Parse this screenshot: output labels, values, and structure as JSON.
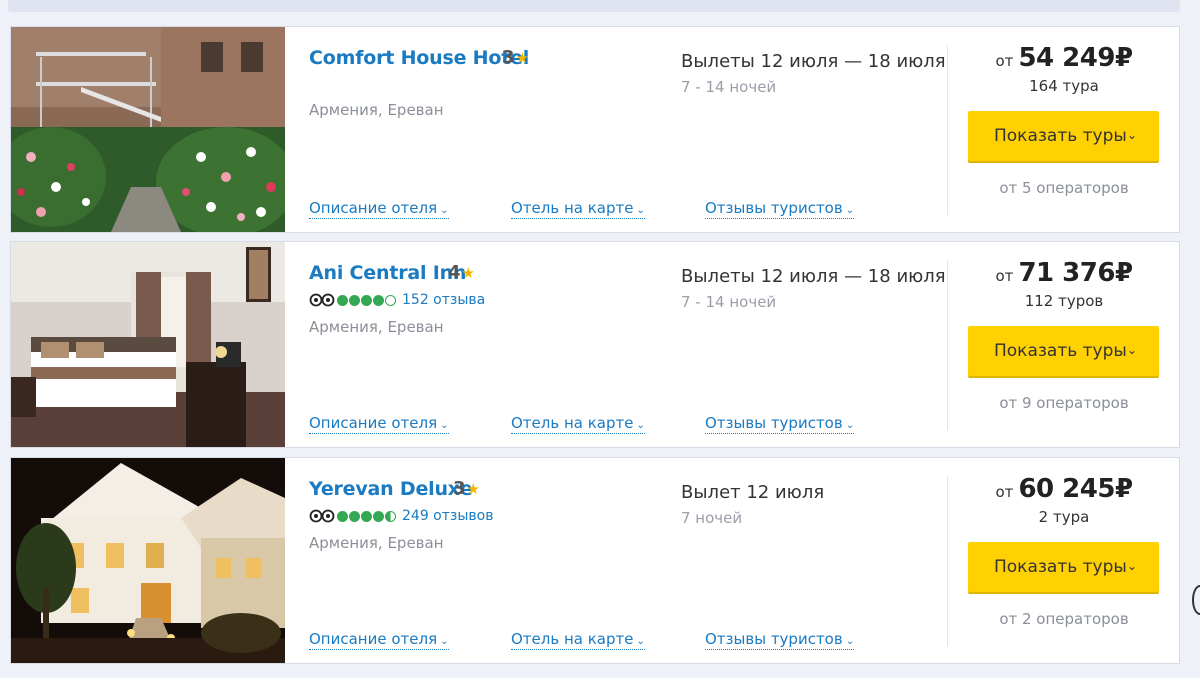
{
  "hotels": [
    {
      "name": "Comfort House Hotel",
      "stars": "3",
      "location": "Армения, Ереван",
      "has_rating": false,
      "dates": "Вылеты 12 июля — 18 июля",
      "nights": "7 - 14 ночей",
      "price_from": "от",
      "price": "54 249₽",
      "tours": "164 тура",
      "button": "Показать туры",
      "operators": "от 5 операторов",
      "links": [
        "Описание отеля",
        "Отель на карте",
        "Отзывы туристов"
      ]
    },
    {
      "name": "Ani Central Inn",
      "stars": "4",
      "location": "Армения, Ереван",
      "has_rating": true,
      "rating_bubbles": 4,
      "reviews": "152 отзыва",
      "dates": "Вылеты 12 июля — 18 июля",
      "nights": "7 - 14 ночей",
      "price_from": "от",
      "price": "71 376₽",
      "tours": "112 туров",
      "button": "Показать туры",
      "operators": "от 9 операторов",
      "links": [
        "Описание отеля",
        "Отель на карте",
        "Отзывы туристов"
      ]
    },
    {
      "name": "Yerevan Deluxe",
      "stars": "3",
      "location": "Армения, Ереван",
      "has_rating": true,
      "rating_bubbles": 4.5,
      "reviews": "249 отзывов",
      "dates": "Вылет 12 июля",
      "nights": "7 ночей",
      "price_from": "от",
      "price": "60 245₽",
      "tours": "2 тура",
      "button": "Показать туры",
      "operators": "от 2 операторов",
      "links": [
        "Описание отеля",
        "Отель на карте",
        "Отзывы туристов"
      ]
    }
  ],
  "icons": {
    "star": "star-icon",
    "chevron": "chevron-down-icon",
    "tripadvisor": "tripadvisor-owl-icon"
  },
  "colors": {
    "link": "#1a7ac2",
    "button": "#ffd100",
    "rating": "#34a853",
    "star": "#f5b800"
  }
}
